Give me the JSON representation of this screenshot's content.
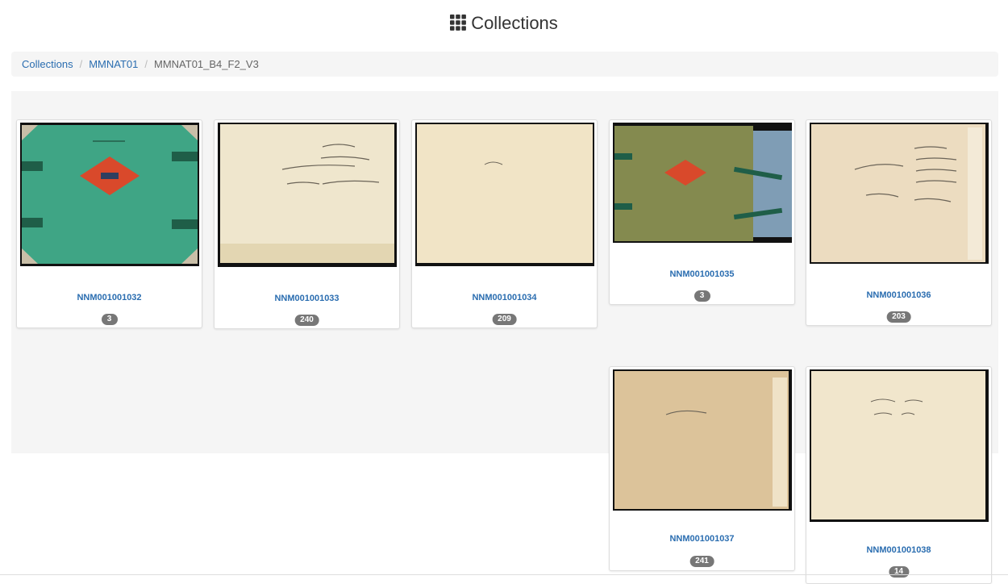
{
  "header": {
    "title": "Collections",
    "icon": "grid-icon"
  },
  "breadcrumb": {
    "items": [
      "Collections",
      "MMNAT01"
    ],
    "active": "MMNAT01_B4_F2_V3"
  },
  "items": [
    {
      "id": "NNM001001032",
      "count": "3"
    },
    {
      "id": "NNM001001033",
      "count": "240"
    },
    {
      "id": "NNM001001034",
      "count": "209"
    },
    {
      "id": "NNM001001035",
      "count": "3"
    },
    {
      "id": "NNM001001036",
      "count": "203"
    },
    {
      "id": "NNM001001037",
      "count": "241"
    },
    {
      "id": "NNM001001038",
      "count": "14"
    }
  ],
  "colors": {
    "link": "#2a6db0",
    "badge": "#777777",
    "well": "#f5f5f5"
  }
}
